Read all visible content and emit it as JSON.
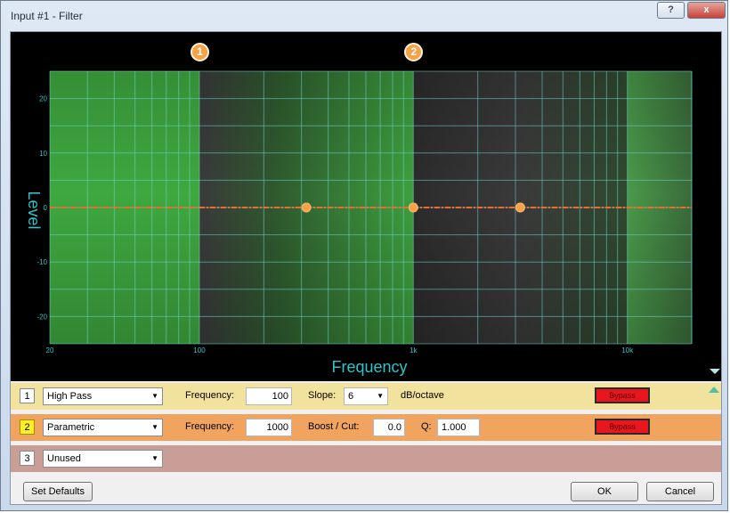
{
  "window": {
    "title": "Input #1 - Filter",
    "help_label": "?",
    "close_label": "x"
  },
  "chart_data": {
    "type": "line",
    "title": "",
    "xlabel": "Frequency",
    "ylabel": "Level",
    "x_scale": "log",
    "xlim": [
      20,
      20000
    ],
    "ylim": [
      -25,
      25
    ],
    "x_ticks": [
      {
        "value": 20,
        "label": "20"
      },
      {
        "value": 100,
        "label": "100"
      },
      {
        "value": 1000,
        "label": "1k"
      },
      {
        "value": 10000,
        "label": "10k"
      }
    ],
    "y_ticks": [
      20,
      10,
      0,
      -10,
      -20
    ],
    "grid": true,
    "background_bands": [
      {
        "from": 20,
        "to": 100,
        "color": "#3fa83f"
      },
      {
        "from": 100,
        "to": 1000,
        "color": "gradient-dark-to-green"
      },
      {
        "from": 1000,
        "to": 10000,
        "color": "dark"
      },
      {
        "from": 10000,
        "to": 20000,
        "color": "#3a7a3a"
      }
    ],
    "series": [
      {
        "points": [
          [
            20,
            0
          ],
          [
            20000,
            0
          ]
        ],
        "color": "#f26a2a"
      }
    ],
    "points": [
      {
        "x": 316,
        "y": 0
      },
      {
        "x": 1000,
        "y": 0
      },
      {
        "x": 3160,
        "y": 0
      }
    ],
    "filter_markers": [
      {
        "label": "1",
        "x": 100
      },
      {
        "label": "2",
        "x": 1000
      }
    ]
  },
  "filters": [
    {
      "number": "1",
      "type": "High Pass",
      "frequency_label": "Frequency:",
      "frequency": "100",
      "slope_label": "Slope:",
      "slope": "6",
      "slope_unit": "dB/octave",
      "bypass_label": "Bypass",
      "color": "#f1e39d"
    },
    {
      "number": "2",
      "type": "Parametric",
      "frequency_label": "Frequency:",
      "frequency": "1000",
      "boost_label": "Boost / Cut:",
      "boost": "0.0",
      "q_label": "Q:",
      "q": "1.000",
      "bypass_label": "Bypass",
      "color": "#f1a45f"
    },
    {
      "number": "3",
      "type": "Unused",
      "color": "#c99e96"
    }
  ],
  "buttons": {
    "set_defaults": "Set Defaults",
    "ok": "OK",
    "cancel": "Cancel"
  },
  "colors": {
    "accent_cyan": "#2ec4c9",
    "marker": "#f6a248",
    "bypass": "#e8161e"
  }
}
